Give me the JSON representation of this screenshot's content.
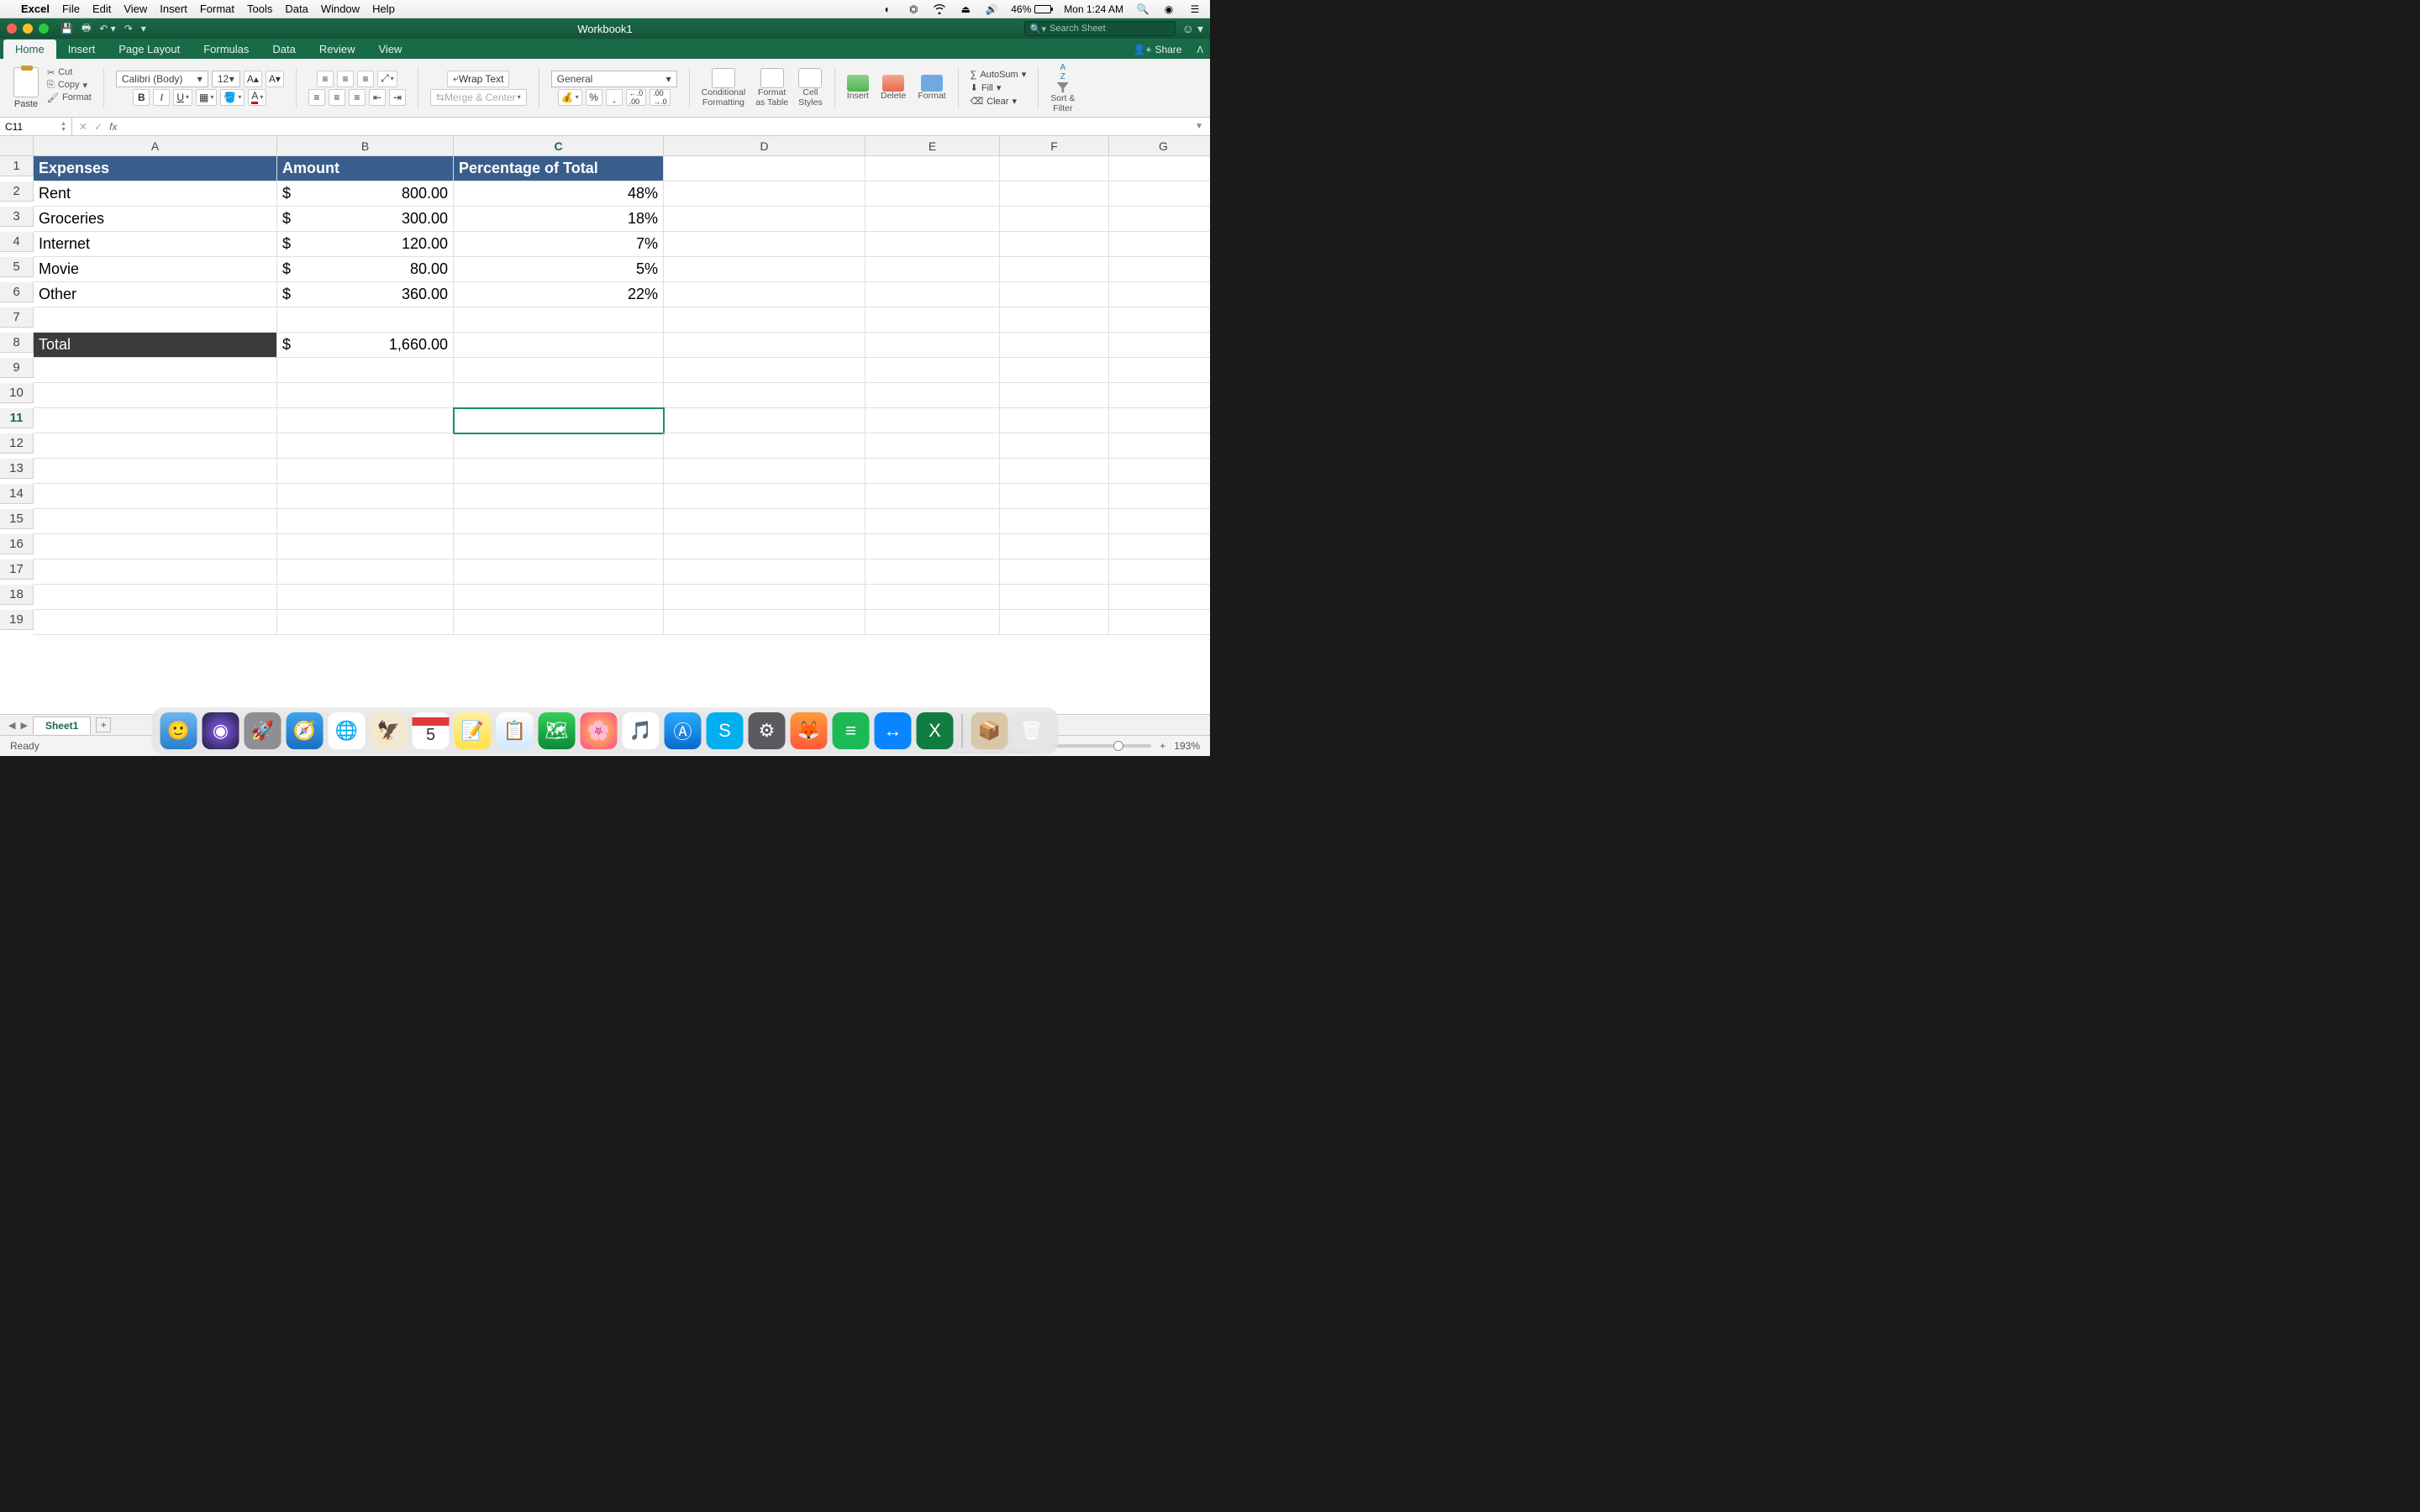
{
  "menubar": {
    "app": "Excel",
    "items": [
      "File",
      "Edit",
      "View",
      "Insert",
      "Format",
      "Tools",
      "Data",
      "Window",
      "Help"
    ],
    "battery": "46%",
    "clock": "Mon 1:24 AM"
  },
  "titlebar": {
    "title": "Workbook1",
    "search_placeholder": "Search Sheet"
  },
  "ribbon_tabs": [
    "Home",
    "Insert",
    "Page Layout",
    "Formulas",
    "Data",
    "Review",
    "View"
  ],
  "ribbon_active_tab": "Home",
  "share_label": "Share",
  "ribbon": {
    "paste": "Paste",
    "cut": "Cut",
    "copy": "Copy",
    "format_painter": "Format",
    "font_name": "Calibri (Body)",
    "font_size": "12",
    "wrap_text": "Wrap Text",
    "merge_center": "Merge & Center",
    "number_format": "General",
    "cond_fmt": "Conditional\nFormatting",
    "fmt_table": "Format\nas Table",
    "cell_styles": "Cell\nStyles",
    "insert": "Insert",
    "delete": "Delete",
    "format": "Format",
    "autosum": "AutoSum",
    "fill": "Fill",
    "clear": "Clear",
    "sort_filter": "Sort &\nFilter"
  },
  "namebox": "C11",
  "formula": "",
  "columns": [
    "A",
    "B",
    "C",
    "D",
    "E",
    "F",
    "G"
  ],
  "selected_cell": {
    "row": 11,
    "col": "C"
  },
  "headers": {
    "A": "Expenses",
    "B": "Amount",
    "C": "Percentage of Total"
  },
  "rows": [
    {
      "label": "Rent",
      "amount": "800.00",
      "pct": "48%"
    },
    {
      "label": "Groceries",
      "amount": "300.00",
      "pct": "18%"
    },
    {
      "label": "Internet",
      "amount": "120.00",
      "pct": "7%"
    },
    {
      "label": "Movie",
      "amount": "80.00",
      "pct": "5%"
    },
    {
      "label": "Other",
      "amount": "360.00",
      "pct": "22%"
    }
  ],
  "total": {
    "label": "Total",
    "amount": "1,660.00"
  },
  "currency_symbol": "$",
  "sheet_tab": "Sheet1",
  "status": "Ready",
  "zoom": "193%"
}
